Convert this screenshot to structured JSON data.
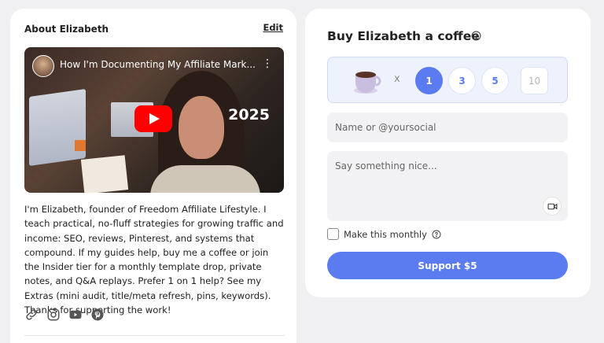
{
  "about": {
    "title": "About Elizabeth",
    "edit_label": "Edit",
    "video": {
      "title": "How I'm Documenting My Affiliate Mark...",
      "year_overlay": "2025"
    },
    "bio": "I'm Elizabeth, founder of Freedom Affiliate Lifestyle. I teach practical, no-fluff strategies for growing traffic and income: SEO, reviews, Pinterest, and systems that compound. If my guides help, buy me a coffee or join the Insider tier for a monthly template drop, private notes, and Q&A replays. Prefer 1 on 1 help? See my Extras (mini audit, title/meta refresh, pins, keywords). Thanks for supporting the work!",
    "socials": [
      "link-icon",
      "instagram-icon",
      "youtube-icon",
      "pinterest-icon"
    ]
  },
  "coffee": {
    "title": "Buy Elizabeth a coffee",
    "times": "x",
    "quantities": [
      "1",
      "3",
      "5"
    ],
    "selected_quantity": "1",
    "custom_placeholder": "10",
    "name_placeholder": "Name or @yoursocial",
    "message_placeholder": "Say something nice...",
    "monthly_label": "Make this monthly",
    "support_label": "Support $5"
  },
  "colors": {
    "accent": "#5b7cf0",
    "page_bg": "#f0f0f2"
  }
}
